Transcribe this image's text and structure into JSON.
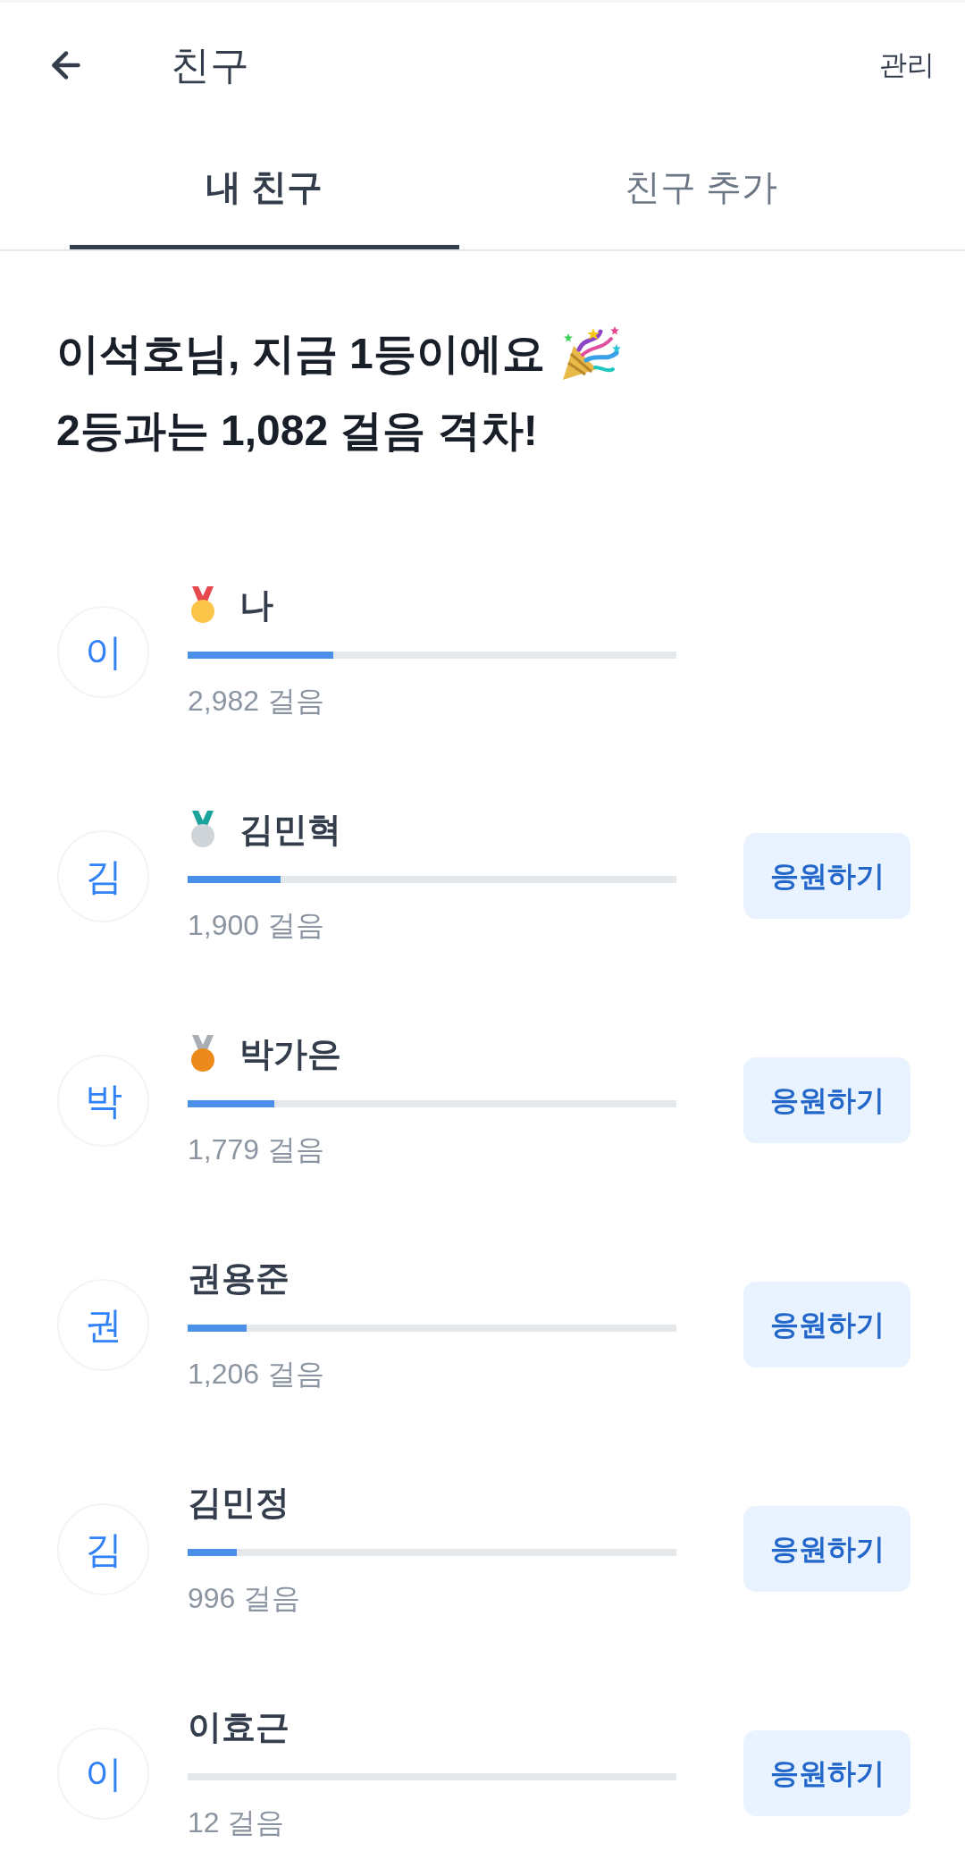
{
  "header": {
    "title": "친구",
    "action": "관리"
  },
  "tabs": [
    {
      "label": "내 친구",
      "selected": true
    },
    {
      "label": "친구 추가",
      "selected": false
    }
  ],
  "headline": [
    "이석호님, 지금 1등이에요",
    "2등과는 1,082 걸음 격차!"
  ],
  "friends": [
    {
      "kind": "gold",
      "initial": "이",
      "name": "나",
      "level": 0.298,
      "steps": "2,982 걸음"
    },
    {
      "kind": "silver",
      "initial": "김",
      "name": "김민혁",
      "level": 0.19,
      "steps": "1,900 걸음",
      "button": "응원하기"
    },
    {
      "kind": "bronze",
      "initial": "박",
      "name": "박가은",
      "level": 0.178,
      "steps": "1,779 걸음",
      "button": "응원하기"
    },
    {
      "kind": "plain",
      "initial": "권",
      "name": "권용준",
      "level": 0.12,
      "steps": "1,206 걸음",
      "button": "응원하기"
    },
    {
      "kind": "plain",
      "initial": "김",
      "name": "김민정",
      "level": 0.1,
      "steps": "996 걸음",
      "button": "응원하기"
    },
    {
      "kind": "plain",
      "initial": "이",
      "name": "이효근",
      "level": 0,
      "steps": "12 걸음",
      "button": "응원하기"
    }
  ]
}
